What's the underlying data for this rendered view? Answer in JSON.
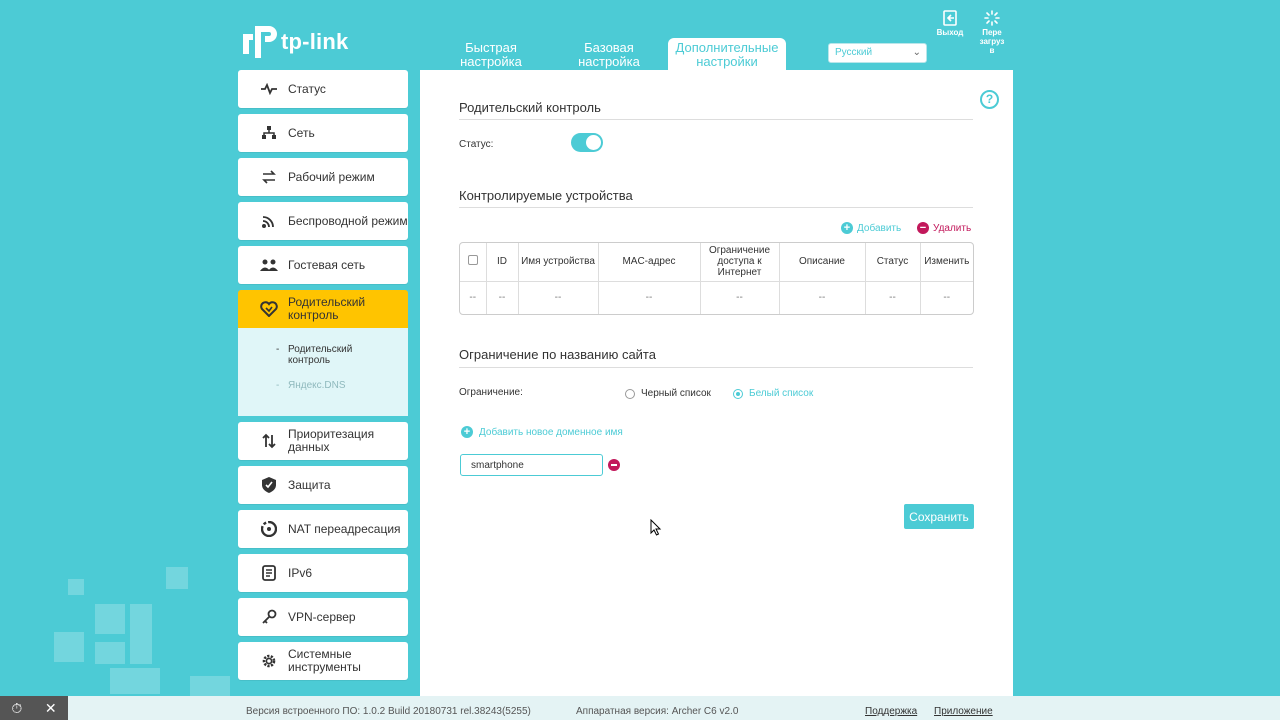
{
  "header": {
    "logo_text": "tp-link",
    "tabs": [
      {
        "label_line1": "Быстрая",
        "label_line2": "настройка"
      },
      {
        "label_line1": "Базовая",
        "label_line2": "настройка"
      },
      {
        "label_line1": "Дополнительные",
        "label_line2": "настройки"
      }
    ],
    "language": "Русский",
    "logout_label": "Выход",
    "reboot_label_1": "Пере",
    "reboot_label_2": "загруз",
    "reboot_label_3": "в"
  },
  "sidebar": {
    "items": [
      {
        "label": "Статус",
        "icon": "pulse-icon"
      },
      {
        "label": "Сеть",
        "icon": "network-icon"
      },
      {
        "label": "Рабочий режим",
        "icon": "mode-icon"
      },
      {
        "label": "Беспроводной режим",
        "icon": "wireless-icon"
      },
      {
        "label": "Гостевая сеть",
        "icon": "guest-icon"
      },
      {
        "label": "Родительский контроль",
        "icon": "parental-heart-icon"
      },
      {
        "label": "Приоритезация данных",
        "icon": "qos-arrows-icon"
      },
      {
        "label": "Защита",
        "icon": "shield-icon"
      },
      {
        "label": "NAT переадресация",
        "icon": "nat-icon"
      },
      {
        "label": "IPv6",
        "icon": "ipv6-icon"
      },
      {
        "label": "VPN-сервер",
        "icon": "vpn-key-icon"
      },
      {
        "label": "Системные инструменты",
        "icon": "gear-icon"
      }
    ],
    "subitems": [
      {
        "label": "Родительский контроль"
      },
      {
        "label": "Яндекс.DNS"
      }
    ]
  },
  "main": {
    "section1_title": "Родительский контроль",
    "status_label": "Статус:",
    "status_enabled": true,
    "section2_title": "Контролируемые устройства",
    "add_label": "Добавить",
    "delete_label": "Удалить",
    "table": {
      "headers": [
        "ID",
        "Имя устройства",
        "MAC-адрес",
        "Ограничение доступа к Интернет",
        "Описание",
        "Статус",
        "Изменить"
      ],
      "row": [
        "--",
        "--",
        "--",
        "--",
        "--",
        "--",
        "--",
        "--"
      ]
    },
    "section3_title": "Ограничение по названию сайта",
    "restriction_label": "Ограничение:",
    "blacklist_label": "Черный список",
    "whitelist_label": "Белый список",
    "selected_mode": "whitelist",
    "add_domain_label": "Добавить новое доменное имя",
    "domain_value": "smartphone",
    "save_label": "Сохранить"
  },
  "footer": {
    "firmware": "Версия встроенного ПО: 1.0.2 Build 20180731 rel.38243(5255)",
    "hardware": "Аппаратная версия: Archer C6 v2.0",
    "support": "Поддержка",
    "app": "Приложение"
  },
  "colors": {
    "accent": "#4ccbd5",
    "active_nav": "#ffc400",
    "delete": "#c2185b"
  }
}
